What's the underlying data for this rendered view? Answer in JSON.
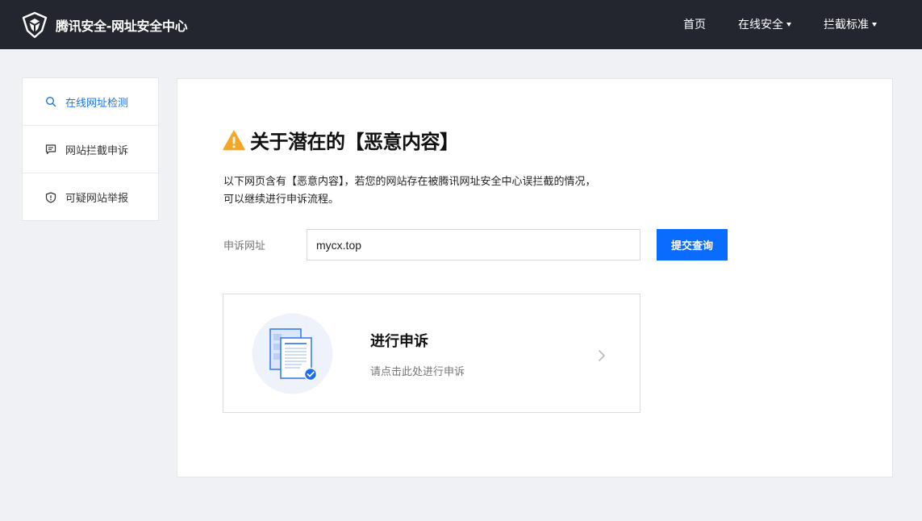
{
  "header": {
    "brand_title": "腾讯安全-网址安全中心",
    "nav": {
      "home": "首页",
      "online_security": "在线安全",
      "block_standard": "拦截标准"
    }
  },
  "sidebar": {
    "items": [
      {
        "label": "在线网址检测",
        "icon": "search-icon",
        "active": true
      },
      {
        "label": "网站拦截申诉",
        "icon": "chat-icon",
        "active": false
      },
      {
        "label": "可疑网站举报",
        "icon": "shield-icon",
        "active": false
      }
    ]
  },
  "main": {
    "headline": "关于潜在的【恶意内容】",
    "description_line1": "以下网页含有【恶意内容】，若您的网站存在被腾讯网址安全中心误拦截的情况，",
    "description_line2": "可以继续进行申诉流程。",
    "url_label": "申诉网址",
    "url_value": "mycx.top",
    "submit_label": "提交查询",
    "appeal": {
      "title": "进行申诉",
      "subtitle": "请点击此处进行申诉"
    }
  },
  "colors": {
    "header_bg": "#23262f",
    "accent": "#0a6cff",
    "active_link": "#1a73e8",
    "warning": "#f5a623",
    "page_bg": "#f0f1f5"
  }
}
